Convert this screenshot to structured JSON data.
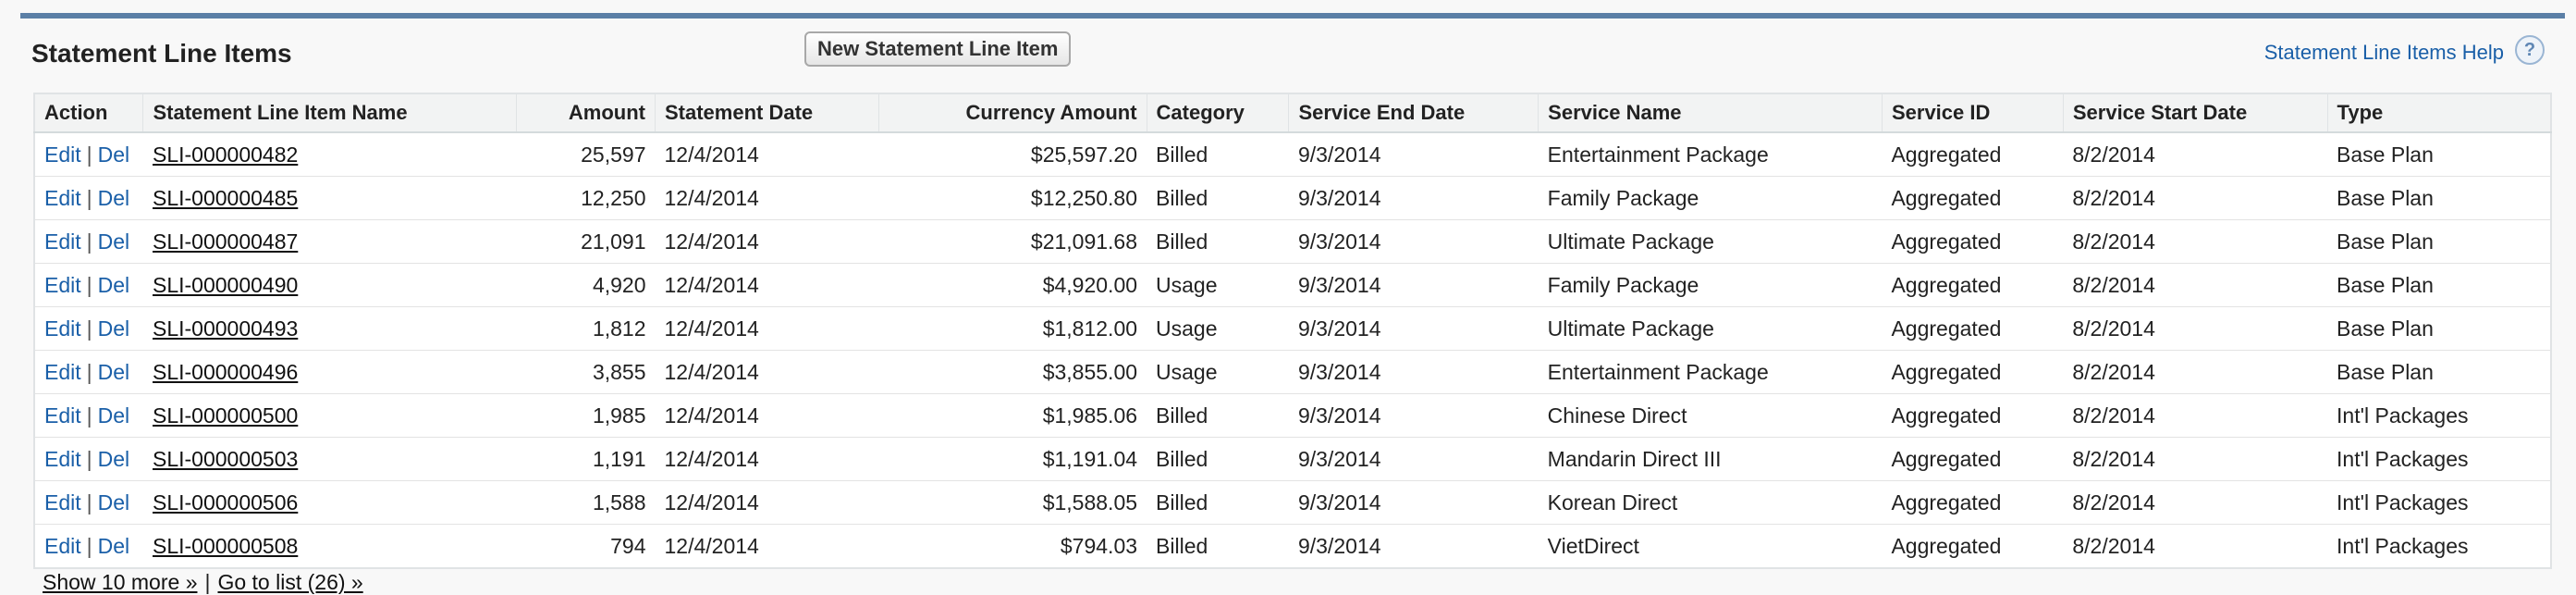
{
  "section": {
    "title": "Statement Line Items",
    "new_button": "New Statement Line Item",
    "help_link": "Statement Line Items Help",
    "help_icon": "?"
  },
  "table": {
    "columns": [
      "Action",
      "Statement Line Item Name",
      "Amount",
      "Statement Date",
      "Currency Amount",
      "Category",
      "Service End Date",
      "Service Name",
      "Service ID",
      "Service Start Date",
      "Type"
    ],
    "action_edit": "Edit",
    "action_sep": "|",
    "action_del": "Del",
    "rows": [
      {
        "name": "SLI-000000482",
        "amount": "25,597",
        "statement_date": "12/4/2014",
        "currency_amount": "$25,597.20",
        "category": "Billed",
        "service_end": "9/3/2014",
        "service_name": "Entertainment Package",
        "service_id": "Aggregated",
        "service_start": "8/2/2014",
        "type": "Base Plan"
      },
      {
        "name": "SLI-000000485",
        "amount": "12,250",
        "statement_date": "12/4/2014",
        "currency_amount": "$12,250.80",
        "category": "Billed",
        "service_end": "9/3/2014",
        "service_name": "Family Package",
        "service_id": "Aggregated",
        "service_start": "8/2/2014",
        "type": "Base Plan"
      },
      {
        "name": "SLI-000000487",
        "amount": "21,091",
        "statement_date": "12/4/2014",
        "currency_amount": "$21,091.68",
        "category": "Billed",
        "service_end": "9/3/2014",
        "service_name": "Ultimate Package",
        "service_id": "Aggregated",
        "service_start": "8/2/2014",
        "type": "Base Plan"
      },
      {
        "name": "SLI-000000490",
        "amount": "4,920",
        "statement_date": "12/4/2014",
        "currency_amount": "$4,920.00",
        "category": "Usage",
        "service_end": "9/3/2014",
        "service_name": "Family Package",
        "service_id": "Aggregated",
        "service_start": "8/2/2014",
        "type": "Base Plan"
      },
      {
        "name": "SLI-000000493",
        "amount": "1,812",
        "statement_date": "12/4/2014",
        "currency_amount": "$1,812.00",
        "category": "Usage",
        "service_end": "9/3/2014",
        "service_name": "Ultimate Package",
        "service_id": "Aggregated",
        "service_start": "8/2/2014",
        "type": "Base Plan"
      },
      {
        "name": "SLI-000000496",
        "amount": "3,855",
        "statement_date": "12/4/2014",
        "currency_amount": "$3,855.00",
        "category": "Usage",
        "service_end": "9/3/2014",
        "service_name": "Entertainment Package",
        "service_id": "Aggregated",
        "service_start": "8/2/2014",
        "type": "Base Plan"
      },
      {
        "name": "SLI-000000500",
        "amount": "1,985",
        "statement_date": "12/4/2014",
        "currency_amount": "$1,985.06",
        "category": "Billed",
        "service_end": "9/3/2014",
        "service_name": "Chinese Direct",
        "service_id": "Aggregated",
        "service_start": "8/2/2014",
        "type": "Int'l Packages"
      },
      {
        "name": "SLI-000000503",
        "amount": "1,191",
        "statement_date": "12/4/2014",
        "currency_amount": "$1,191.04",
        "category": "Billed",
        "service_end": "9/3/2014",
        "service_name": "Mandarin Direct III",
        "service_id": "Aggregated",
        "service_start": "8/2/2014",
        "type": "Int'l Packages"
      },
      {
        "name": "SLI-000000506",
        "amount": "1,588",
        "statement_date": "12/4/2014",
        "currency_amount": "$1,588.05",
        "category": "Billed",
        "service_end": "9/3/2014",
        "service_name": "Korean Direct",
        "service_id": "Aggregated",
        "service_start": "8/2/2014",
        "type": "Int'l Packages"
      },
      {
        "name": "SLI-000000508",
        "amount": "794",
        "statement_date": "12/4/2014",
        "currency_amount": "$794.03",
        "category": "Billed",
        "service_end": "9/3/2014",
        "service_name": "VietDirect",
        "service_id": "Aggregated",
        "service_start": "8/2/2014",
        "type": "Int'l Packages"
      }
    ]
  },
  "footer": {
    "show_more": "Show 10 more »",
    "sep": "|",
    "go_to_list": "Go to list (26) »"
  }
}
